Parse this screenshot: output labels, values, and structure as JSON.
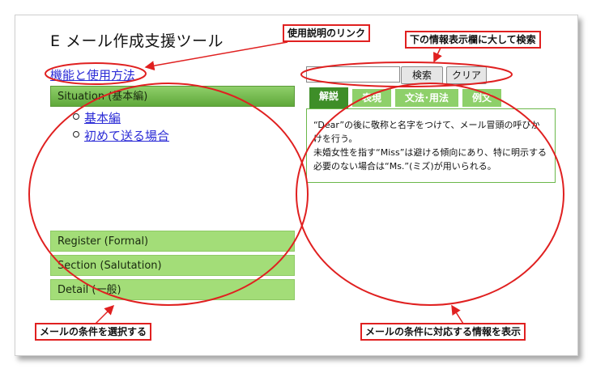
{
  "app": {
    "title": "E メール作成支援ツール",
    "help_link": "機能と使用方法"
  },
  "search": {
    "value": "",
    "search_label": "検索",
    "clear_label": "クリア"
  },
  "accordion": {
    "open_section": "Situation (基本編)",
    "items": [
      "基本編",
      "初めて送る場合"
    ],
    "sections": [
      "Register (Formal)",
      "Section (Salutation)",
      "Detail (一般)"
    ]
  },
  "tabs": [
    {
      "label": "解説",
      "active": true
    },
    {
      "label": "表現",
      "active": false
    },
    {
      "label": "文法･用法",
      "active": false
    },
    {
      "label": "例文",
      "active": false
    }
  ],
  "content": {
    "line1": "“Dear”の後に敬称と名字をつけて、メール冒頭の呼びかけを行う。",
    "line2": "未婚女性を指す“Miss”は避ける傾向にあり、特に明示する必要のない場合は“Ms.”(ミズ)が用いられる。"
  },
  "annotations": {
    "help_link_note": "使用説明のリンク",
    "search_note": "下の情報表示欄に大して検索",
    "left_note": "メールの条件を選択する",
    "right_note": "メールの条件に対応する情報を表示"
  },
  "colors": {
    "annotation_red": "#e02020",
    "accordion_green": "#a3dd78",
    "tab_active_green": "#3e8e28",
    "link_blue": "#2b2bd6"
  }
}
